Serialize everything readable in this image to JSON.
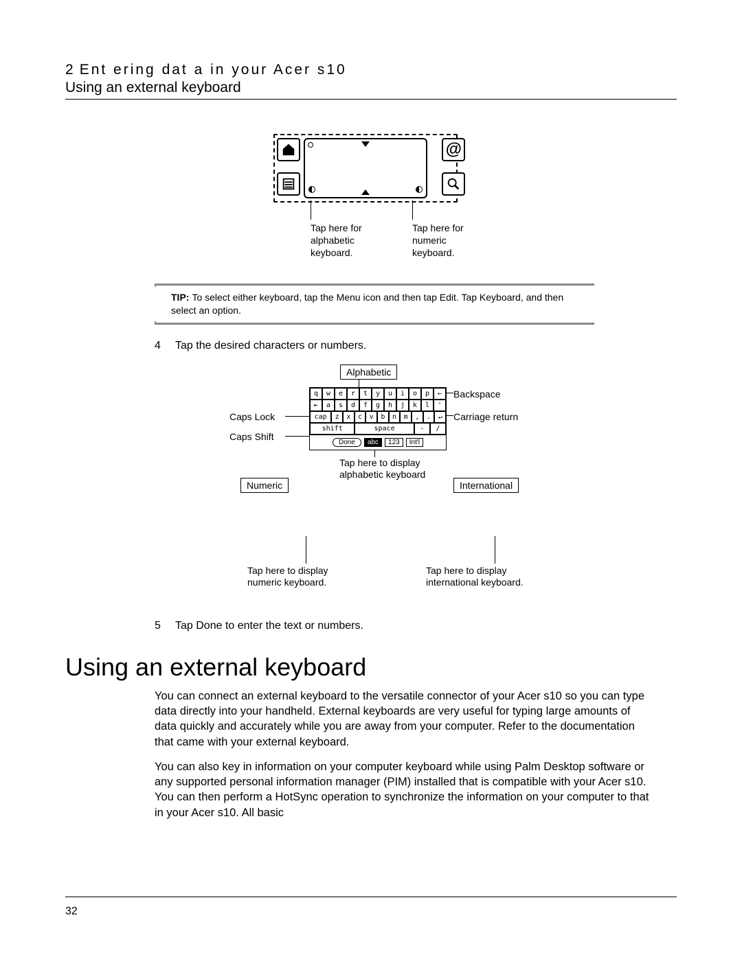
{
  "header": {
    "chapter_number": "2",
    "chapter_title": "Ent ering dat a in your Acer s10",
    "section": "Using an external keyboard"
  },
  "diagram1": {
    "icons": {
      "home": "home-icon",
      "menu": "menu-icon",
      "at": "@",
      "find": "find-icon"
    },
    "caption_a": "Tap here for alphabetic keyboard.",
    "caption_b": "Tap here for numeric keyboard."
  },
  "tip": {
    "label": "TIP:",
    "text": "To select either keyboard, tap the Menu icon and then tap Edit. Tap Keyboard, and then select an option."
  },
  "steps": {
    "s4_num": "4",
    "s4_text": "Tap the desired characters or numbers.",
    "s5_num": "5",
    "s5_text": "Tap Done to enter the text or numbers."
  },
  "diagram2": {
    "box_alpha": "Alphabetic",
    "box_numeric": "Numeric",
    "box_intl": "International",
    "label_caps": "Caps Lock",
    "label_shift": "Caps Shift",
    "label_back": "Backspace",
    "label_cr": "Carriage return",
    "label_tap_alpha": "Tap here to display alphabetic keyboard",
    "label_tap_num": "Tap here to display numeric keyboard.",
    "label_tap_intl": "Tap here to display international keyboard.",
    "keys_row1": [
      "q",
      "w",
      "e",
      "r",
      "t",
      "y",
      "u",
      "i",
      "o",
      "p",
      "←"
    ],
    "keys_row2": [
      "⇤",
      "a",
      "s",
      "d",
      "f",
      "g",
      "h",
      "j",
      "k",
      "l",
      "'"
    ],
    "keys_row3": [
      "cap",
      "z",
      "x",
      "c",
      "v",
      "b",
      "n",
      "m",
      ",",
      ".",
      "↵"
    ],
    "keys_row4_shift": "shift",
    "keys_row4_space": "space",
    "keys_row4_dash": "-",
    "keys_row4_slash": "/",
    "btn_done": "Done",
    "tab_abc": "abc",
    "tab_123": "123",
    "tab_intl": "Int'l"
  },
  "section": {
    "title": "Using an external keyboard",
    "para1": "You can connect an external keyboard to the versatile connector of your Acer s10 so you can type data directly into your handheld. External keyboards are very useful for typing large amounts of data quickly and accurately while you are away from your computer. Refer to the documentation that came with your external keyboard.",
    "para2": "You can also key in information on your computer keyboard while using Palm Desktop software or any supported personal information manager (PIM) installed that is compatible with your Acer s10. You can then perform a HotSync operation to synchronize the information on your computer to that in your Acer s10. All basic"
  },
  "page_number": "32"
}
